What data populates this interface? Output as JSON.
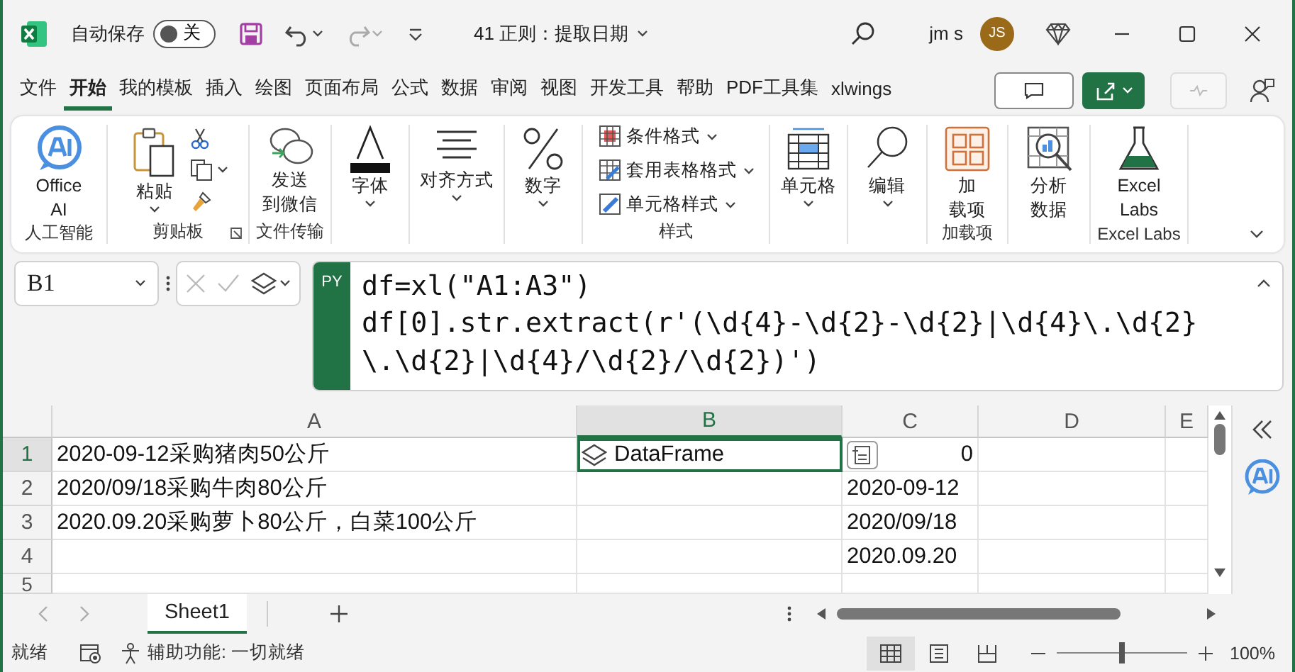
{
  "title_bar": {
    "autosave_label": "自动保存",
    "autosave_on": false,
    "autosave_state": "关",
    "document_title": "41 正则：提取日期",
    "user_name": "jm s",
    "user_initials": "JS"
  },
  "ribbon_tabs": [
    {
      "label": "文件",
      "selected": false
    },
    {
      "label": "开始",
      "selected": true
    },
    {
      "label": "我的模板",
      "selected": false
    },
    {
      "label": "插入",
      "selected": false
    },
    {
      "label": "绘图",
      "selected": false
    },
    {
      "label": "页面布局",
      "selected": false
    },
    {
      "label": "公式",
      "selected": false
    },
    {
      "label": "数据",
      "selected": false
    },
    {
      "label": "审阅",
      "selected": false
    },
    {
      "label": "视图",
      "selected": false
    },
    {
      "label": "开发工具",
      "selected": false
    },
    {
      "label": "帮助",
      "selected": false
    },
    {
      "label": "PDF工具集",
      "selected": false
    },
    {
      "label": "xlwings",
      "selected": false
    }
  ],
  "ribbon_groups": [
    {
      "label": "人工智能",
      "items": [
        {
          "kind": "large",
          "lines": [
            "Office",
            "AI"
          ],
          "dropdown": false
        }
      ]
    },
    {
      "label": "剪贴板",
      "launcher": true,
      "items": [
        {
          "kind": "large",
          "lines": [
            "粘贴"
          ],
          "dropdown": true
        },
        {
          "kind": "small_icons"
        }
      ]
    },
    {
      "label": "文件传输",
      "items": [
        {
          "kind": "large",
          "lines": [
            "发送",
            "到微信"
          ],
          "dropdown": false
        }
      ]
    },
    {
      "items": [
        {
          "kind": "large",
          "lines": [
            "字体"
          ],
          "dropdown": true
        }
      ]
    },
    {
      "items": [
        {
          "kind": "large",
          "lines": [
            "对齐方式"
          ],
          "dropdown": true
        }
      ]
    },
    {
      "items": [
        {
          "kind": "large",
          "lines": [
            "数字"
          ],
          "dropdown": true
        }
      ]
    },
    {
      "label": "样式",
      "items": [
        {
          "kind": "list",
          "entries": [
            "条件格式",
            "套用表格格式",
            "单元格样式"
          ]
        }
      ]
    },
    {
      "items": [
        {
          "kind": "large",
          "lines": [
            "单元格"
          ],
          "dropdown": true
        }
      ]
    },
    {
      "items": [
        {
          "kind": "large",
          "lines": [
            "编辑"
          ],
          "dropdown": true
        }
      ]
    },
    {
      "label": "加载项",
      "items": [
        {
          "kind": "large",
          "lines": [
            "加",
            "载项"
          ],
          "dropdown": false
        }
      ]
    },
    {
      "items": [
        {
          "kind": "large",
          "lines": [
            "分析",
            "数据"
          ],
          "dropdown": false
        }
      ]
    },
    {
      "label": "Excel Labs",
      "items": [
        {
          "kind": "large",
          "lines": [
            "Excel",
            "Labs"
          ],
          "dropdown": false
        }
      ]
    }
  ],
  "formula_bar": {
    "name_box": "B1",
    "badge": "PY",
    "code_lines": [
      "df=xl(\"A1:A3\")",
      "df[0].str.extract(r'(\\d{4}-\\d{2}-\\d{2}|\\d{4}\\.\\d{2}",
      "\\.\\d{2}|\\d{4}/\\d{2}/\\d{2})')"
    ]
  },
  "sheet": {
    "columns": [
      {
        "label": "A",
        "selected": false
      },
      {
        "label": "B",
        "selected": true
      },
      {
        "label": "C",
        "selected": false
      },
      {
        "label": "D",
        "selected": false
      },
      {
        "label": "E",
        "selected": false
      }
    ],
    "rows": [
      {
        "label": "1",
        "selected": true,
        "cells": [
          {
            "kind": "text",
            "text": "2020-09-12采购猪肉50公斤",
            "selected": false
          },
          {
            "kind": "python",
            "text": "DataFrame",
            "selected": true,
            "card_button": true
          },
          {
            "kind": "number",
            "text": "0",
            "selected": false
          },
          null,
          null
        ]
      },
      {
        "label": "2",
        "selected": false,
        "cells": [
          {
            "kind": "text",
            "text": "2020/09/18采购牛肉80公斤",
            "selected": false
          },
          null,
          {
            "kind": "text",
            "text": "2020-09-12",
            "selected": false
          },
          null,
          null
        ]
      },
      {
        "label": "3",
        "selected": false,
        "cells": [
          {
            "kind": "text",
            "text": "2020.09.20采购萝卜80公斤，白菜100公斤",
            "selected": false
          },
          null,
          {
            "kind": "text",
            "text": "2020/09/18",
            "selected": false
          },
          null,
          null
        ]
      },
      {
        "label": "4",
        "selected": false,
        "cells": [
          null,
          null,
          {
            "kind": "text",
            "text": "2020.09.20",
            "selected": false
          },
          null,
          null
        ]
      },
      {
        "label": "5",
        "selected": false
      }
    ]
  },
  "sheet_tabs": [
    {
      "label": "Sheet1",
      "selected": true
    }
  ],
  "status_bar": {
    "ready": "就绪",
    "accessibility": "辅助功能: 一切就绪",
    "views": [
      {
        "selected": true
      },
      {
        "selected": false
      },
      {
        "selected": false
      }
    ],
    "zoom": {
      "level": 0.5,
      "reading": "100%"
    }
  }
}
